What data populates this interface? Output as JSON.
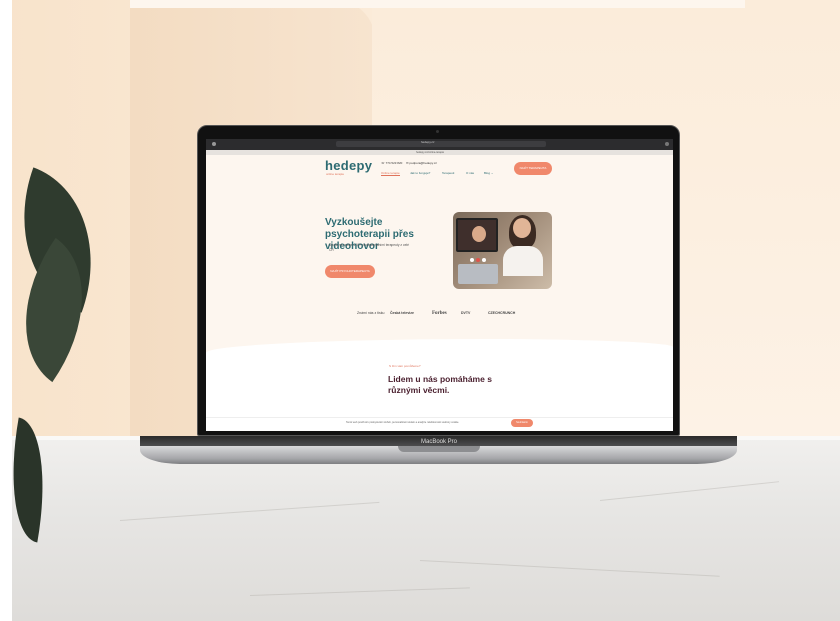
{
  "scene": {
    "device_label": "MacBook Pro"
  },
  "browser": {
    "tab_title": "hedepy.cz",
    "url": "hedepy.cz/online-terapie"
  },
  "site": {
    "logo": "hedepy",
    "logo_sub": "online terapie",
    "phone": "774 523 820",
    "email": "podpora@hedepy.cz",
    "cta": "NAJÍT TERAPEUTA",
    "nav": [
      "Online terapie",
      "Jak to funguje?",
      "Terapeuti",
      "O nás",
      "Blog"
    ],
    "hero_title": "Vyzkoušejte psychoterapii přes videohovor",
    "hero_lead": "Spojte se online s 90+ profesionálními terapeuty z celé ČR",
    "hero_button": "NAJÍT PSYCHOTERAPEUTA",
    "press": [
      "Známí nás z tisku",
      "Česká televize",
      "Forbes",
      "DVTV",
      "CZECHCRUNCH"
    ],
    "kicker": "S čím vám pomůžeme?",
    "section_title": "Lidem u nás pomáháme s různými věcmi.",
    "cookie_text": "Tento web používá k poskytování služeb, personalizaci reklam a analýze návštěvnosti soubory cookie.",
    "cookie_button": "Souhlasím"
  },
  "colors": {
    "brand": "#2d6b72",
    "accent": "#f0886b",
    "dark": "#4a1f2e"
  }
}
